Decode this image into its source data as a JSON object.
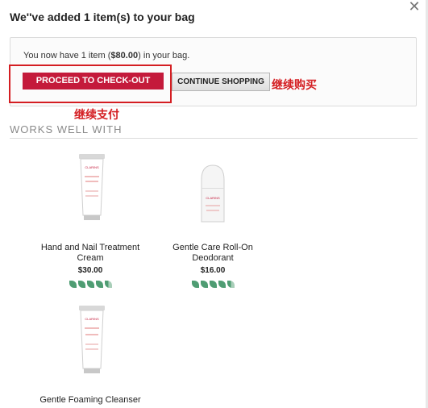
{
  "modal": {
    "title": "We''ve added 1 item(s) to your bag",
    "close_label": "✕"
  },
  "cart": {
    "message_prefix": "You now have 1 item (",
    "message_amount": "$80.00",
    "message_suffix": ") in your bag.",
    "checkout_label": "PROCEED TO CHECK-OUT",
    "continue_label": "CONTINUE SHOPPING"
  },
  "annotations": {
    "continue_note": "继续购买",
    "pay_note": "继续支付"
  },
  "recommendations": {
    "title": "WORKS WELL WITH",
    "products": [
      {
        "name": "Hand and Nail Treatment Cream",
        "price": "$30.00",
        "rating": 4.5,
        "image": "tube-icon"
      },
      {
        "name": "Gentle Care Roll-On Deodorant",
        "price": "$16.00",
        "rating": 4.5,
        "image": "bottle-icon"
      },
      {
        "name": "Gentle Foaming Cleanser",
        "price": "",
        "rating": 0,
        "image": "tube-icon"
      }
    ]
  },
  "colors": {
    "checkout_red": "#c41a3b",
    "annotation_red": "#d41e22",
    "leaf_green": "#4f9d73"
  }
}
